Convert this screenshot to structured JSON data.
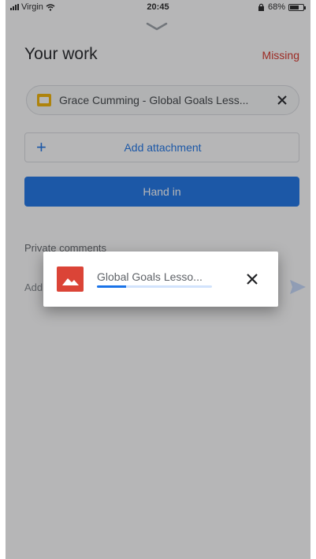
{
  "status_bar": {
    "carrier": "Virgin",
    "time": "20:45",
    "battery_text": "68%",
    "battery_level": 0.68
  },
  "header": {
    "title": "Your work",
    "status": "Missing"
  },
  "attachment": {
    "label": "Grace Cumming - Global Goals Less...",
    "icon": "slides-icon"
  },
  "add_attachment": {
    "label": "Add attachment"
  },
  "hand_in": {
    "label": "Hand in"
  },
  "private_comments": {
    "label": "Private comments",
    "placeholder": "Add"
  },
  "upload": {
    "file_name": "Global Goals Lesso...",
    "progress": 0.25,
    "icon": "image-icon"
  },
  "colors": {
    "accent": "#1a73e8",
    "missing": "#d93025",
    "upload_icon": "#db4437",
    "slides_icon": "#f4b400"
  }
}
